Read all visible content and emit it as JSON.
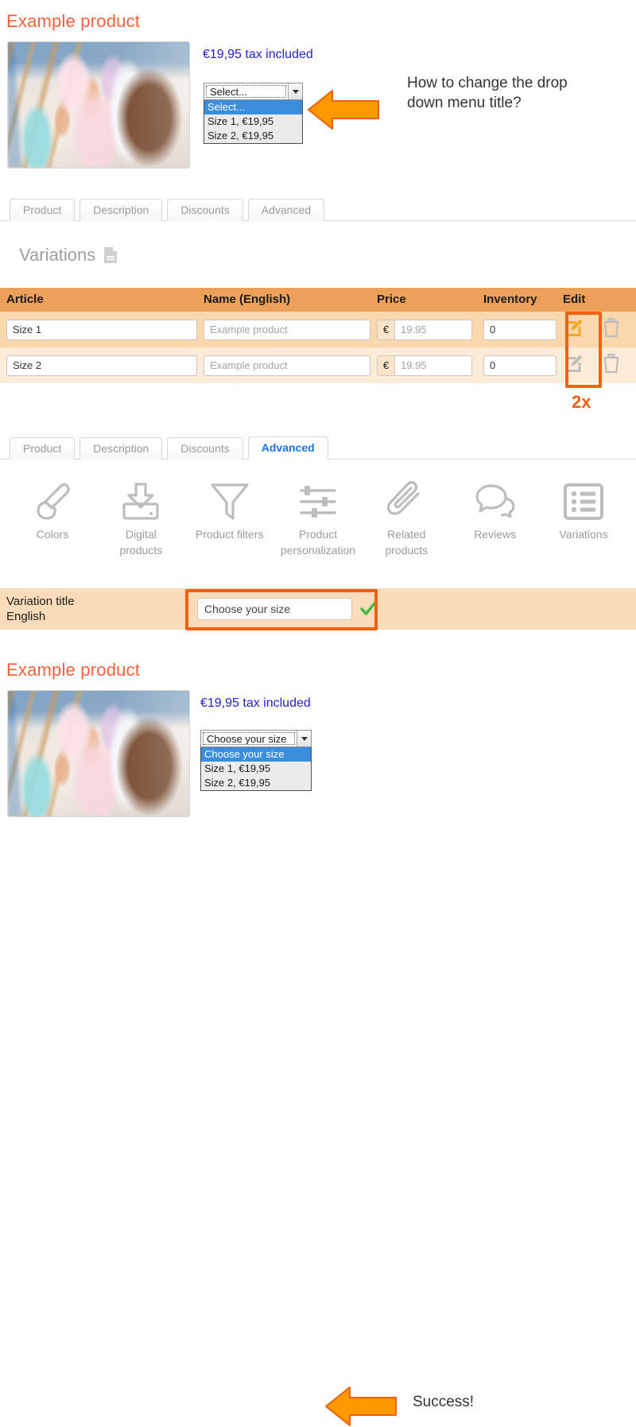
{
  "top_section": {
    "product_title": "Example product",
    "price_text": "€19,95 tax included",
    "select": {
      "value": "Select...",
      "options": [
        "Select...",
        "Size 1, €19,95",
        "Size 2, €19,95"
      ]
    },
    "callout": "How to change the drop down menu title?"
  },
  "tabs_top": [
    {
      "label": "Product",
      "active": false
    },
    {
      "label": "Description",
      "active": false
    },
    {
      "label": "Discounts",
      "active": false
    },
    {
      "label": "Advanced",
      "active": false
    }
  ],
  "variations": {
    "heading": "Variations",
    "heading_icon": "document-icon",
    "columns": [
      "Article",
      "Name (English)",
      "Price",
      "Inventory",
      "Edit"
    ],
    "rows": [
      {
        "article": "Size 1",
        "name_placeholder": "Example product",
        "currency": "€",
        "price_placeholder": "19.95",
        "inventory": "0",
        "edit_icon": "edit-icon",
        "delete_icon": "trash-icon",
        "edit_highlighted": true
      },
      {
        "article": "Size 2",
        "name_placeholder": "Example product",
        "currency": "€",
        "price_placeholder": "19.95",
        "inventory": "0",
        "edit_icon": "edit-icon",
        "delete_icon": "trash-icon",
        "edit_highlighted": false
      }
    ],
    "annotation": "2x"
  },
  "tabs_bottom": [
    {
      "label": "Product",
      "active": false
    },
    {
      "label": "Description",
      "active": false
    },
    {
      "label": "Discounts",
      "active": false
    },
    {
      "label": "Advanced",
      "active": true
    }
  ],
  "advanced_icons": [
    {
      "label": "Colors",
      "icon": "paintbrush-icon"
    },
    {
      "label": "Digital products",
      "icon": "download-tray-icon"
    },
    {
      "label": "Product filters",
      "icon": "funnel-icon"
    },
    {
      "label": "Product personalization",
      "icon": "sliders-icon"
    },
    {
      "label": "Related products",
      "icon": "paperclip-icon"
    },
    {
      "label": "Reviews",
      "icon": "speech-bubbles-icon"
    },
    {
      "label": "Variations",
      "icon": "list-icon"
    }
  ],
  "variation_title": {
    "label_line1": "Variation title",
    "label_line2": "English",
    "value": "Choose your size",
    "status_icon": "green-check-icon"
  },
  "bottom_section": {
    "product_title": "Example product",
    "price_text": "€19,95 tax included",
    "select": {
      "value": "Choose your size",
      "options": [
        "Choose your size",
        "Size 1, €19,95",
        "Size 2, €19,95"
      ]
    },
    "callout": "Success!"
  },
  "colors": {
    "title_orange": "#f4613c",
    "price_blue": "#2222cc",
    "arrow_orange": "#ff9900",
    "highlight_orange": "#f3600f",
    "table_header": "#eda05a",
    "row_1": "#fbd7ae",
    "row_2": "#fdecd8",
    "active_tab_blue": "#1a73e8",
    "check_green": "#3fb93f"
  }
}
